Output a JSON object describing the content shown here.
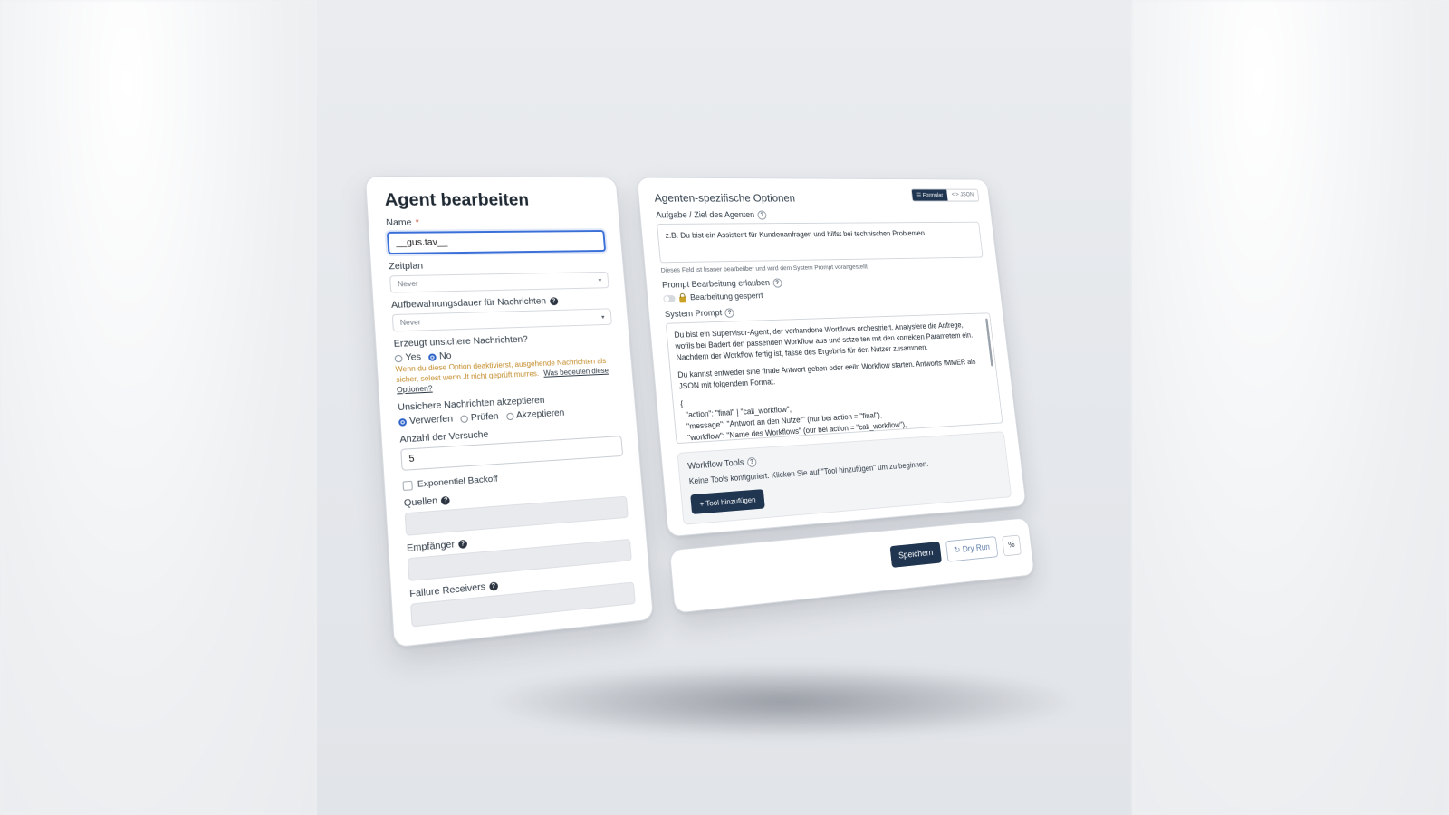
{
  "left": {
    "title": "Agent bearbeiten",
    "name_label": "Name",
    "name_required": "*",
    "name_value": "__gus.tav__",
    "schedule_label": "Zeitplan",
    "schedule_value": "Never",
    "retention_label": "Aufbewahrungsdauer für Nachrichten",
    "retention_value": "Never",
    "unsafe_label": "Erzeugt unsichere Nachrichten?",
    "unsafe_yes": "Yes",
    "unsafe_no": "No",
    "unsafe_selected": "No",
    "unsafe_warning": "Wenn du diese Option deaktivierst, ausgehende Nachrichten als sicher, selest wenn Jt nicht geprüft murres.",
    "unsafe_link": "Was bedeuten diese Optionen?",
    "accept_label": "Unsichere Nachrichten akzeptieren",
    "accept_options": [
      "Verwerfen",
      "Prüfen",
      "Akzeptieren"
    ],
    "accept_selected": "Verwerfen",
    "attempts_label": "Anzahl der Versuche",
    "attempts_value": "5",
    "backoff_label": "Exponentiel Backoff",
    "sources_label": "Quellen",
    "recipients_label": "Empfänger",
    "failure_label": "Failure Receivers"
  },
  "right": {
    "title": "Agenten-spezifische Optionen",
    "view_toggle": [
      "Formular",
      "JSON"
    ],
    "view_active": "Formular",
    "task_label": "Aufgabe / Ziel des Agenten",
    "task_placeholder": "z.B. Du bist ein Assistent für Kundenanfragen und hilfst bei technischen Problemen...",
    "task_hint": "Dieses Feld ist lisaner bearbeilber und wird dem System Prompt vorangestellt.",
    "prompt_edit_label": "Prompt Bearbeitung erlauben",
    "lock_text": "Bearbeitung gesperrt",
    "system_prompt_label": "System Prompt",
    "system_prompt_p1": "Du bist ein Supervisor-Agent, der vorhandone Wortflows orchestriert. Analysiere die Anfrege, wofils bei Badert den passenden Workflow aus und sstze ten mit den korrekten Parametem ein. Nachdem der Workflow fertig ist, fasse des Ergebnis für den Nutzer zusammen.",
    "system_prompt_p2": "Du kannst entweder sine finale Antwort geben oder eeiln Workflow starten. Antworts IMMER als JSON mit folgendem Format.",
    "system_prompt_code": "{\n  \"action\": \"final\" | \"call_workflow\",\n  \"message\": \"Antwort an den Nutzer\" (nur bei action = \"final\"),\n  \"workflow\": \"Name des Workflows\" (our bei action = \"call_workflow\"),",
    "tools_label": "Workflow Tools",
    "tools_empty": "Keine Tools konfiguriert. Klicken Sie auf \"Tool hinzufügen\" um zu beginnen.",
    "add_tool": "+ Tool hinzufügen"
  },
  "actions": {
    "save": "Speichern",
    "dry_run": "Dry Run",
    "dry_run_icon": "refresh-icon",
    "extra_icon": "percent-icon"
  },
  "colors": {
    "primary": "#1f3550",
    "warning": "#c28a27",
    "focus": "#3a6fd8"
  }
}
